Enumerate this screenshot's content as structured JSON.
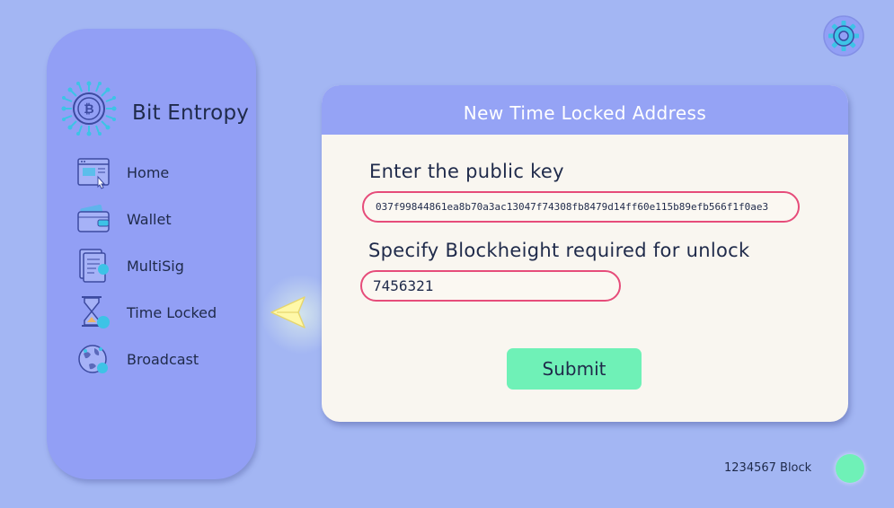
{
  "sidebar": {
    "brand": "Bit Entropy",
    "items": [
      {
        "label": "Home",
        "icon": "browser-window-icon"
      },
      {
        "label": "Wallet",
        "icon": "wallet-icon"
      },
      {
        "label": "MultiSig",
        "icon": "document-icon"
      },
      {
        "label": "Time Locked",
        "icon": "hourglass-icon"
      },
      {
        "label": "Broadcast",
        "icon": "globe-icon"
      }
    ]
  },
  "form": {
    "title": "New Time Locked Address",
    "pubkey_label": "Enter the public key",
    "pubkey_value": "037f99844861ea8b70a3ac13047f74308fb8479d14ff60e115b89efb566f1f0ae3",
    "blockheight_label": "Specify Blockheight required for unlock",
    "blockheight_value": "7456321",
    "submit_label": "Submit"
  },
  "status": {
    "block_text": "1234567 Block",
    "indicator_color": "#6ff1b7"
  },
  "colors": {
    "background": "#a3b6f3",
    "sidebar": "#929ff5",
    "card_header": "#95a3f5",
    "field_border": "#e64c7a",
    "accent_green": "#6ff1b7"
  }
}
